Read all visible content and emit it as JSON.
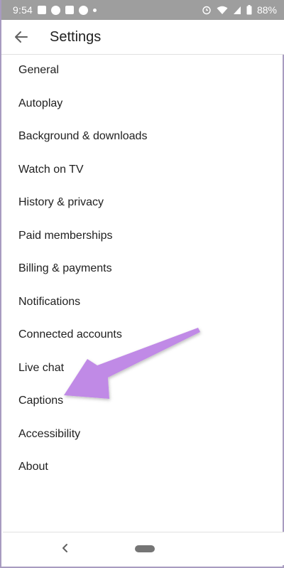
{
  "status_bar": {
    "time": "9:54",
    "battery": "88%",
    "icons_left": [
      "image-icon",
      "whatsapp-icon",
      "photo-icon",
      "pinterest-icon",
      "notification-dot-icon"
    ],
    "icons_right": [
      "alarm-icon",
      "wifi-icon",
      "signal-icon",
      "battery-icon"
    ]
  },
  "toolbar": {
    "title": "Settings",
    "back_icon": "arrow-left-icon"
  },
  "settings": {
    "items": [
      {
        "label": "General"
      },
      {
        "label": "Autoplay"
      },
      {
        "label": "Background & downloads"
      },
      {
        "label": "Watch on TV"
      },
      {
        "label": "History & privacy"
      },
      {
        "label": "Paid memberships"
      },
      {
        "label": "Billing & payments"
      },
      {
        "label": "Notifications"
      },
      {
        "label": "Connected accounts"
      },
      {
        "label": "Live chat"
      },
      {
        "label": "Captions"
      },
      {
        "label": "Accessibility"
      },
      {
        "label": "About"
      }
    ]
  },
  "annotation": {
    "arrow_color": "#c08ae6",
    "points_to": "Captions"
  },
  "nav_bar": {
    "back_icon": "chevron-left-icon",
    "home_icon": "home-pill-icon"
  },
  "colors": {
    "status_bar_bg": "#9e9e9e",
    "text_primary": "#212121",
    "divider": "#e0e0e0"
  }
}
